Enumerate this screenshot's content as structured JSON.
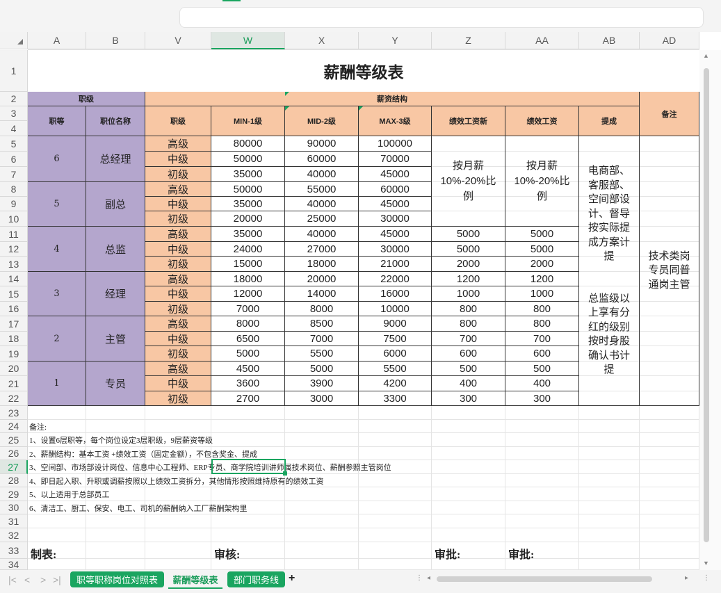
{
  "columns": [
    {
      "label": "A",
      "sel": false
    },
    {
      "label": "B",
      "sel": false
    },
    {
      "label": "V",
      "sel": false
    },
    {
      "label": "W",
      "sel": true
    },
    {
      "label": "X",
      "sel": false
    },
    {
      "label": "Y",
      "sel": false
    },
    {
      "label": "Z",
      "sel": false
    },
    {
      "label": "AA",
      "sel": false
    },
    {
      "label": "AB",
      "sel": false
    },
    {
      "label": "AD",
      "sel": false
    }
  ],
  "rows": [
    "1",
    "2",
    "3",
    "4",
    "5",
    "6",
    "7",
    "8",
    "9",
    "10",
    "11",
    "12",
    "13",
    "14",
    "15",
    "16",
    "17",
    "18",
    "19",
    "20",
    "21",
    "22",
    "23",
    "24",
    "25",
    "26",
    "27",
    "28",
    "29",
    "30",
    "31",
    "32",
    "33",
    "34"
  ],
  "selected_row": "27",
  "title": "薪酬等级表",
  "header": {
    "group_level": "职级",
    "group_salary": "薪资结构",
    "col_rank": "职等",
    "col_position": "职位名称",
    "col_grade": "职级",
    "col_min": "MIN-1级",
    "col_mid": "MID-2级",
    "col_max": "MAX-3级",
    "col_perf_new": "绩效工资新",
    "col_perf": "绩效工资",
    "col_commission": "提成",
    "col_remark": "备注"
  },
  "bands": [
    {
      "rank": "6",
      "position": "总经理",
      "rows": [
        {
          "grade": "高级",
          "min": "80000",
          "mid": "90000",
          "max": "100000"
        },
        {
          "grade": "中级",
          "min": "50000",
          "mid": "60000",
          "max": "70000"
        },
        {
          "grade": "初级",
          "min": "35000",
          "mid": "40000",
          "max": "45000"
        }
      ]
    },
    {
      "rank": "5",
      "position": "副总",
      "rows": [
        {
          "grade": "高级",
          "min": "50000",
          "mid": "55000",
          "max": "60000"
        },
        {
          "grade": "中级",
          "min": "35000",
          "mid": "40000",
          "max": "45000"
        },
        {
          "grade": "初级",
          "min": "20000",
          "mid": "25000",
          "max": "30000"
        }
      ]
    },
    {
      "rank": "4",
      "position": "总监",
      "rows": [
        {
          "grade": "高级",
          "min": "35000",
          "mid": "40000",
          "max": "45000",
          "perf_new": "5000",
          "perf": "5000"
        },
        {
          "grade": "中级",
          "min": "24000",
          "mid": "27000",
          "max": "30000",
          "perf_new": "5000",
          "perf": "5000"
        },
        {
          "grade": "初级",
          "min": "15000",
          "mid": "18000",
          "max": "21000",
          "perf_new": "2000",
          "perf": "2000"
        }
      ]
    },
    {
      "rank": "3",
      "position": "经理",
      "rows": [
        {
          "grade": "高级",
          "min": "18000",
          "mid": "20000",
          "max": "22000",
          "perf_new": "1200",
          "perf": "1200"
        },
        {
          "grade": "中级",
          "min": "12000",
          "mid": "14000",
          "max": "16000",
          "perf_new": "1000",
          "perf": "1000"
        },
        {
          "grade": "初级",
          "min": "7000",
          "mid": "8000",
          "max": "10000",
          "perf_new": "800",
          "perf": "800"
        }
      ]
    },
    {
      "rank": "2",
      "position": "主管",
      "rows": [
        {
          "grade": "高级",
          "min": "8000",
          "mid": "8500",
          "max": "9000",
          "perf_new": "800",
          "perf": "800"
        },
        {
          "grade": "中级",
          "min": "6500",
          "mid": "7000",
          "max": "7500",
          "perf_new": "700",
          "perf": "700"
        },
        {
          "grade": "初级",
          "min": "5000",
          "mid": "5500",
          "max": "6000",
          "perf_new": "600",
          "perf": "600"
        }
      ]
    },
    {
      "rank": "1",
      "position": "专员",
      "rows": [
        {
          "grade": "高级",
          "min": "4500",
          "mid": "5000",
          "max": "5500",
          "perf_new": "500",
          "perf": "500"
        },
        {
          "grade": "中级",
          "min": "3600",
          "mid": "3900",
          "max": "4200",
          "perf_new": "400",
          "perf": "400"
        },
        {
          "grade": "初级",
          "min": "2700",
          "mid": "3000",
          "max": "3300",
          "perf_new": "300",
          "perf": "300"
        }
      ]
    }
  ],
  "merged": {
    "perf_new_top": "按月薪10%-20%比例",
    "perf_top": "按月薪10%-20%比例",
    "commission_1": "电商部、客服部、空间部设计、督导按实际提成方案计提",
    "commission_2": "总监级以上享有分红的级别按时身股确认书计提",
    "remark": "技术类岗专员同普通岗主管"
  },
  "notes": [
    "备注:",
    "1、设置6层职等，每个岗位设定3层职级，9层薪资等级",
    "2、薪酬结构：基本工资 +绩效工资（固定金额），不包含奖金、提成",
    "3、空间部、市场部设计岗位、信息中心工程师、ERP专员、商学院培训讲师属技术岗位、薪酬参照主管岗位",
    "4、即日起入职、升职或调薪按照以上绩效工资拆分，其他情形按照维持原有的绩效工资",
    "5、以上适用于总部员工",
    "6、清洁工、厨工、保安、电工、司机的薪酬纳入工厂薪酬架构里"
  ],
  "signatures": {
    "made_by": "制表:",
    "review": "审核:",
    "approve1": "审批:",
    "approve2": "审批:"
  },
  "tabs": [
    {
      "label": "职等职称岗位对照表",
      "active": false
    },
    {
      "label": "薪酬等级表",
      "active": true
    },
    {
      "label": "部门职务线",
      "active": false
    }
  ],
  "add_tab": "+",
  "nav": {
    "first": "|<",
    "prev": "<",
    "next": ">",
    "last": ">|"
  }
}
